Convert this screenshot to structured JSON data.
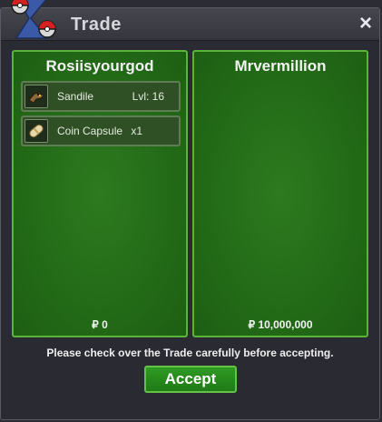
{
  "window": {
    "title": "Trade",
    "close_label": "×"
  },
  "left_panel": {
    "player_name": "Rosiisyourgod",
    "items": [
      {
        "name": "Sandile",
        "detail": "Lvl: 16",
        "icon": "sandile-icon"
      },
      {
        "name": "Coin Capsule",
        "detail": "x1",
        "icon": "coin-capsule-icon"
      }
    ],
    "money": "₽ 0"
  },
  "right_panel": {
    "player_name": "Mrvermillion",
    "items": [],
    "money": "₽ 10,000,000"
  },
  "footer": {
    "notice": "Please check over the Trade carefully before accepting.",
    "accept_label": "Accept"
  },
  "colors": {
    "panel_green": "#236a17",
    "panel_border": "#5ab43a",
    "window_bg": "#2a2a33",
    "accept_button": "#2f9a22"
  }
}
